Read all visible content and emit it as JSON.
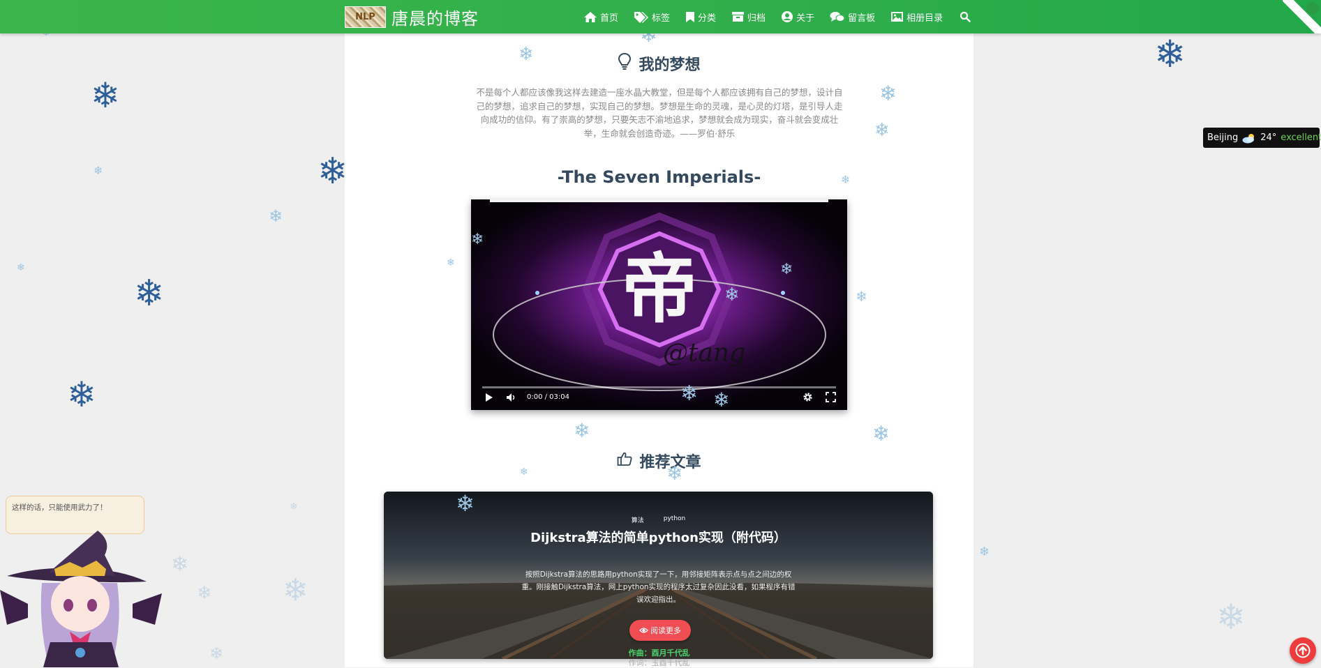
{
  "navbar": {
    "brand_logo_text": "NLP",
    "brand_name": "唐晨的博客",
    "items": [
      {
        "label": "首页",
        "icon": "home-icon"
      },
      {
        "label": "标签",
        "icon": "tags-icon"
      },
      {
        "label": "分类",
        "icon": "bookmark-icon"
      },
      {
        "label": "归档",
        "icon": "archive-icon"
      },
      {
        "label": "关于",
        "icon": "user-circle-icon"
      },
      {
        "label": "留言板",
        "icon": "comments-icon"
      },
      {
        "label": "相册目录",
        "icon": "image-icon"
      }
    ],
    "search_icon": "search-icon",
    "accent_color": "#2fae4b"
  },
  "dream": {
    "title": "我的梦想",
    "text": "不是每个人都应该像我这样去建造一座水晶大教堂，但是每个人都应该拥有自己的梦想，设计自己的梦想，追求自己的梦想，实现自己的梦想。梦想是生命的灵魂，是心灵的灯塔，是引导人走向成功的信仰。有了崇高的梦想，只要矢志不渝地追求，梦想就会成为现实，奋斗就会变成壮举，生命就会创造奇迹。——罗伯·舒乐"
  },
  "music": {
    "title": "-The Seven Imperials-",
    "video_glyph": "帝",
    "watermark": "@tang",
    "time": "0:00 / 03:04",
    "progress_fraction": 0
  },
  "recommended": {
    "title": "推荐文章",
    "article": {
      "tags": [
        "算法",
        "python"
      ],
      "title": "Dijkstra算法的简单python实现（附代码）",
      "excerpt": "按照Dijkstra算法的思路用python实现了一下，用邻接矩阵表示点与点之间边的权重。刚接触Dijkstra算法，网上python实现的程序太过复杂因此没看，如果程序有错误欢迎指出。",
      "read_more": "阅读更多",
      "button_color": "#f14d55"
    }
  },
  "lyrics": {
    "line1": "作曲：酉月千代乱",
    "line2": "作词：玉酉千代乱"
  },
  "weather": {
    "city": "Beijing",
    "temp": "24°",
    "quality": "excellent"
  },
  "mascot": {
    "speech": "这样的话，只能使用武力了！"
  },
  "back_to_top_color": "#ee3b3b"
}
